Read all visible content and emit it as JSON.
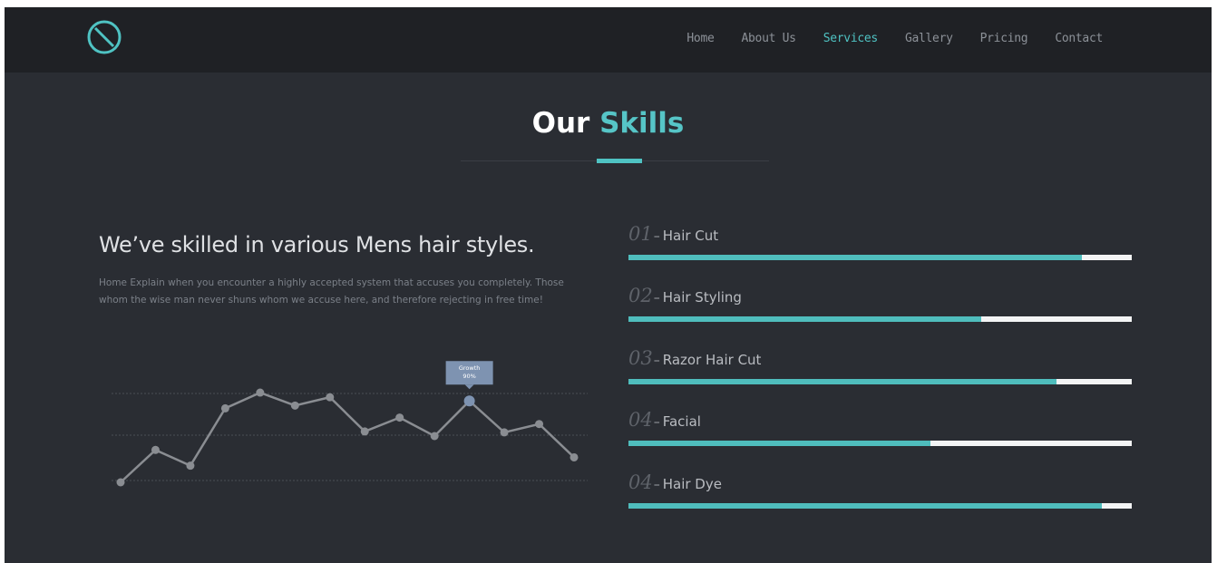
{
  "nav": {
    "items": [
      {
        "label": "Home",
        "active": false
      },
      {
        "label": "About Us",
        "active": false
      },
      {
        "label": "Services",
        "active": true
      },
      {
        "label": "Gallery",
        "active": false
      },
      {
        "label": "Pricing",
        "active": false
      },
      {
        "label": "Contact",
        "active": false
      }
    ],
    "logo_icon": "circle-slash-icon"
  },
  "section": {
    "title_plain": "Our",
    "title_accent": "Skills"
  },
  "intro": {
    "headline": "We’ve skilled in various Mens hair styles.",
    "description": "Home Explain when you encounter a highly accepted system that accuses you completely. Those whom the wise man never shuns whom we accuse here, and therefore rejecting in free time!"
  },
  "chart_data": {
    "type": "line",
    "values": [
      0,
      35,
      18,
      80,
      97,
      83,
      92,
      55,
      70,
      50,
      88,
      54,
      63,
      27
    ],
    "ylim": [
      0,
      100
    ],
    "highlight_index": 10,
    "tooltip": {
      "line1": "Growth",
      "line2": "90%"
    },
    "grid": true
  },
  "skills": [
    {
      "number": "01",
      "name": "Hair Cut",
      "percent": 90
    },
    {
      "number": "02",
      "name": "Hair Styling",
      "percent": 70
    },
    {
      "number": "03",
      "name": "Razor Hair Cut",
      "percent": 85
    },
    {
      "number": "04",
      "name": "Facial",
      "percent": 60
    },
    {
      "number": "04",
      "name": "Hair Dye",
      "percent": 94
    }
  ],
  "colors": {
    "accent": "#4fc3c3",
    "background": "#2a2d33",
    "navbar": "#1f2125",
    "chart_line": "#8a8d92",
    "highlight": "#7e93b1"
  }
}
